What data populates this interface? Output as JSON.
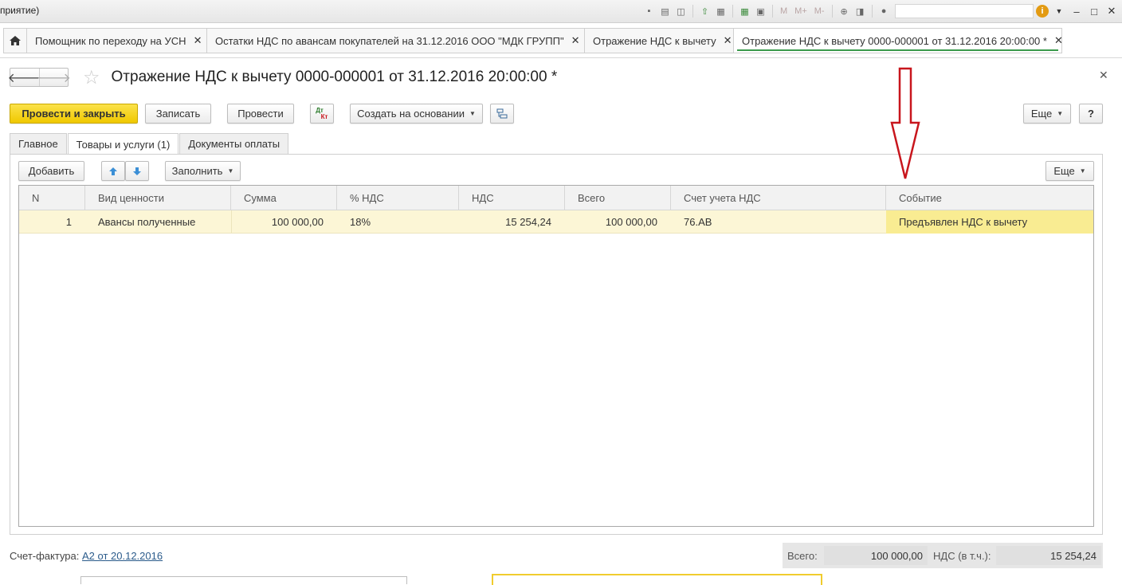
{
  "window": {
    "title": "приятие)"
  },
  "toolbar_icons": [
    "save-icon",
    "print-icon",
    "preview-icon",
    "upload-icon",
    "print-setup-icon",
    "calculator-icon",
    "calendar-icon"
  ],
  "memory": {
    "m": "M",
    "m_plus": "M+",
    "m_minus": "M-"
  },
  "tabs": [
    {
      "label": "Помощник по переходу на УСН",
      "active": false
    },
    {
      "label": "Остатки НДС по авансам покупателей на 31.12.2016 ООО \"МДК ГРУПП\"",
      "active": false
    },
    {
      "label": "Отражение НДС к вычету",
      "active": false
    },
    {
      "label": "Отражение НДС к вычету 0000-000001 от 31.12.2016 20:00:00 *",
      "active": true
    }
  ],
  "document": {
    "title": "Отражение НДС к вычету 0000-000001 от 31.12.2016 20:00:00 *"
  },
  "command_bar": {
    "post_and_close": "Провести и закрыть",
    "save": "Записать",
    "post": "Провести",
    "dt": "Дт",
    "kt": "Кт",
    "create_based_on": "Создать на основании",
    "more": "Еще",
    "help": "?"
  },
  "form_tabs": [
    {
      "label": "Главное",
      "active": false
    },
    {
      "label": "Товары и услуги (1)",
      "active": true
    },
    {
      "label": "Документы оплаты",
      "active": false
    }
  ],
  "table_toolbar": {
    "add": "Добавить",
    "fill": "Заполнить",
    "more": "Еще"
  },
  "table": {
    "columns": [
      "N",
      "Вид ценности",
      "Сумма",
      "% НДС",
      "НДС",
      "Всего",
      "Счет учета НДС",
      "Событие"
    ],
    "rows": [
      {
        "n": "1",
        "kind": "Авансы полученные",
        "sum": "100 000,00",
        "rate": "18%",
        "vat": "15 254,24",
        "total": "100 000,00",
        "account": "76.АВ",
        "event": "Предъявлен НДС к вычету"
      }
    ]
  },
  "footer": {
    "invoice_label": "Счет-фактура:",
    "invoice_link": "А2 от 20.12.2016",
    "total_label": "Всего:",
    "total_value": "100 000,00",
    "vat_label": "НДС (в т.ч.):",
    "vat_value": "15 254,24"
  },
  "colors": {
    "primary_button": "#f5d400",
    "selected_row": "#fcf6d6",
    "annotation_arrow": "#c8161d",
    "active_tab_underline": "#3a9a4c"
  }
}
